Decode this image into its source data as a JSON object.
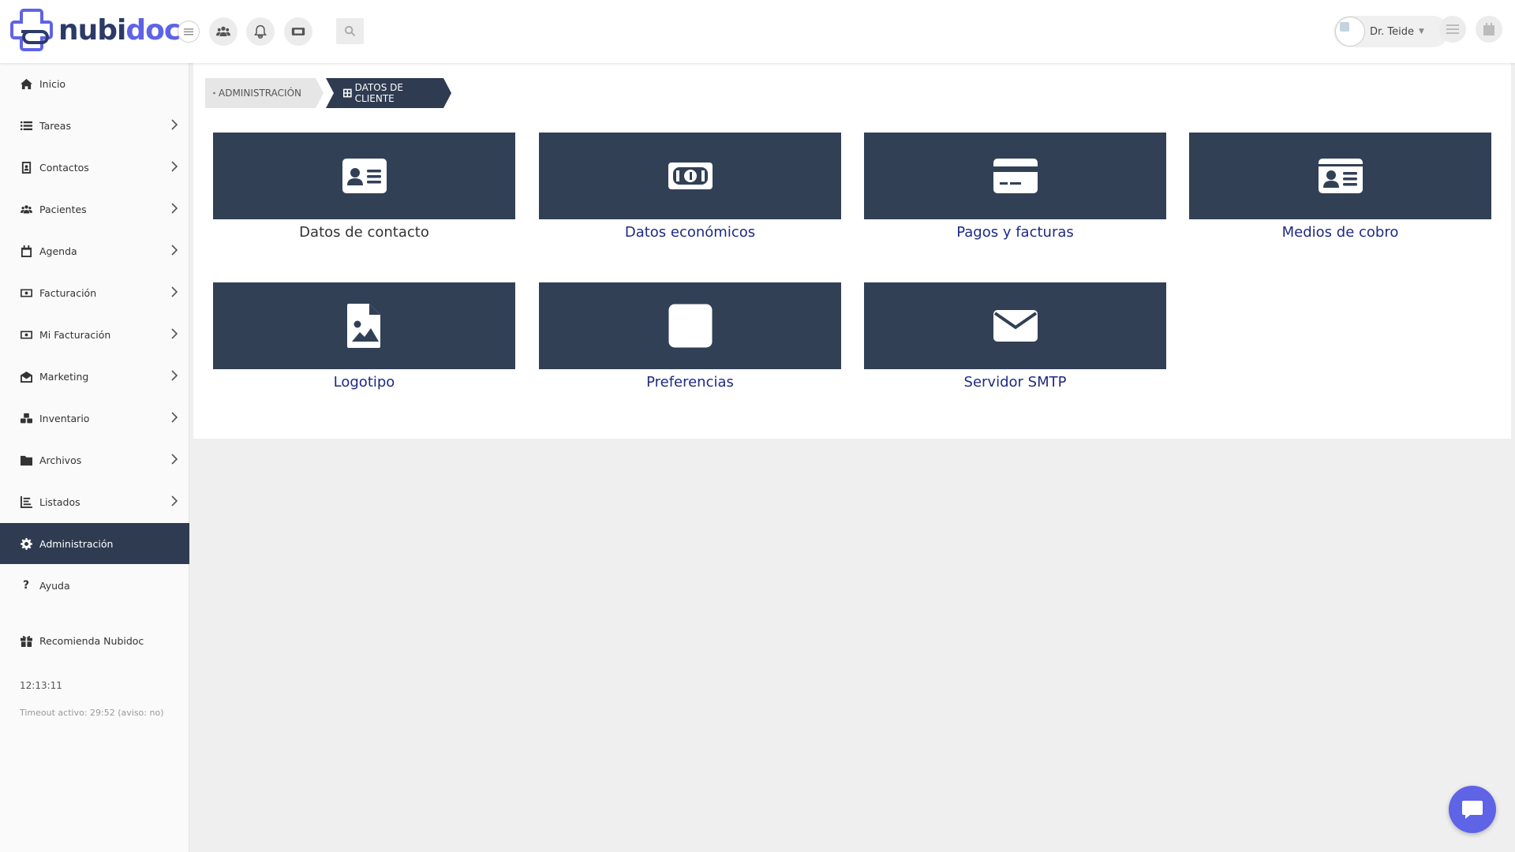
{
  "brand": {
    "name_part1": "nubi",
    "name_part2": "doc",
    "color_primary": "#5f63e6",
    "color_dark": "#2c3a67"
  },
  "topbar": {
    "toggle_icon": "hamburger-icon",
    "icons": [
      "users-icon",
      "bell-icon",
      "ticket-icon",
      "search-icon"
    ],
    "user": {
      "name": "Dr. Teide",
      "caret_icon": "caret-down-icon"
    },
    "right_icons": [
      "list-icon",
      "calendar-icon"
    ]
  },
  "sidebar": {
    "items": [
      {
        "label": "Inicio",
        "icon": "home-icon",
        "has_chevron": false
      },
      {
        "label": "Tareas",
        "icon": "list-icon",
        "has_chevron": true
      },
      {
        "label": "Contactos",
        "icon": "address-book-icon",
        "has_chevron": true
      },
      {
        "label": "Pacientes",
        "icon": "users-icon",
        "has_chevron": true
      },
      {
        "label": "Agenda",
        "icon": "calendar-icon",
        "has_chevron": true
      },
      {
        "label": "Facturación",
        "icon": "money-bill-icon",
        "has_chevron": true
      },
      {
        "label": "Mi Facturación",
        "icon": "money-bill-icon",
        "has_chevron": true
      },
      {
        "label": "Marketing",
        "icon": "envelope-open-icon",
        "has_chevron": true
      },
      {
        "label": "Inventario",
        "icon": "cubes-icon",
        "has_chevron": true
      },
      {
        "label": "Archivos",
        "icon": "folder-icon",
        "has_chevron": true
      },
      {
        "label": "Listados",
        "icon": "chart-icon",
        "has_chevron": true
      },
      {
        "label": "Administración",
        "icon": "gear-icon",
        "has_chevron": false,
        "active": true
      },
      {
        "label": "Ayuda",
        "icon": "question-icon",
        "has_chevron": false
      },
      {
        "label": "Recomienda Nubidoc",
        "icon": "gift-icon",
        "has_chevron": false
      }
    ],
    "clock": "12:13:11",
    "timeout": "Timeout activo: 29:52 (aviso: no)"
  },
  "breadcrumb": [
    {
      "label": "ADMINISTRACIÓN",
      "icon": "gear-icon"
    },
    {
      "label": "DATOS DE CLIENTE",
      "icon": "table-icon"
    }
  ],
  "cards": [
    {
      "label": "Datos de contacto",
      "icon": "id-card-icon"
    },
    {
      "label": "Datos económicos",
      "icon": "money-bill-icon"
    },
    {
      "label": "Pagos y facturas",
      "icon": "credit-card-icon"
    },
    {
      "label": "Medios de cobro",
      "icon": "id-card-alt-icon"
    },
    {
      "label": "Logotipo",
      "icon": "file-image-icon"
    },
    {
      "label": "Preferencias",
      "icon": "square-icon"
    },
    {
      "label": "Servidor SMTP",
      "icon": "envelope-icon"
    }
  ],
  "chat": {
    "icon": "chat-icon",
    "accent": "#5f63e6"
  }
}
